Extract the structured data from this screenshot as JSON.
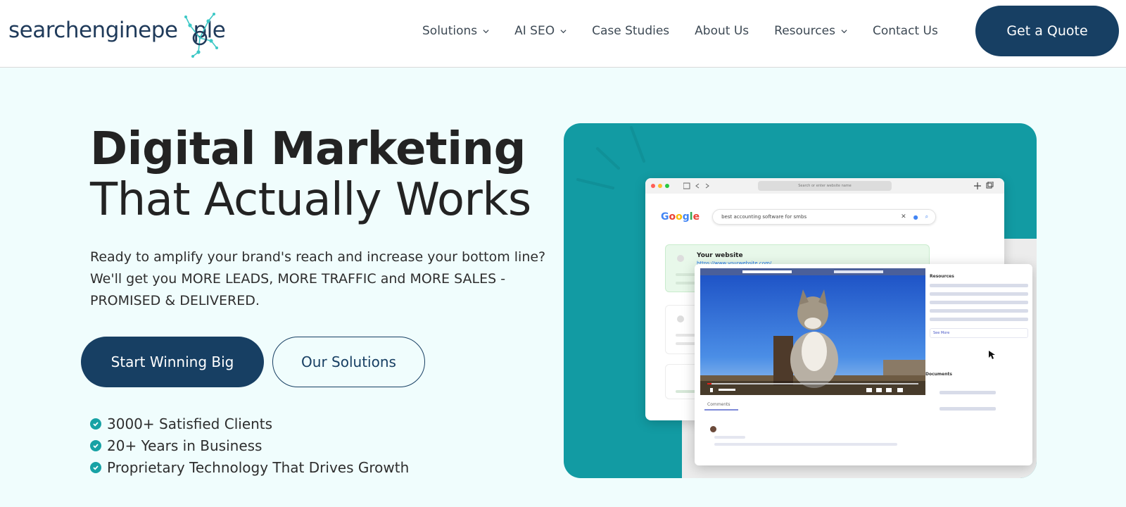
{
  "brand": {
    "logo_text_a": "searchenginepe",
    "logo_text_b": "ple",
    "primary": "#173f63",
    "accent": "#17a2a5",
    "hero_bg": "#f0fdfd"
  },
  "nav": {
    "items": [
      {
        "label": "Solutions",
        "dropdown": true
      },
      {
        "label": "AI SEO",
        "dropdown": true
      },
      {
        "label": "Case Studies",
        "dropdown": false
      },
      {
        "label": "About Us",
        "dropdown": false
      },
      {
        "label": "Resources",
        "dropdown": true
      },
      {
        "label": "Contact Us",
        "dropdown": false
      }
    ],
    "cta": "Get a Quote"
  },
  "hero": {
    "title_line1": "Digital Marketing",
    "title_line2": "That Actually Works",
    "description": "Ready to amplify your brand's reach and increase your bottom line? We'll get you MORE LEADS, MORE TRAFFIC and MORE SALES - PROMISED & DELIVERED.",
    "primary_button": "Start Winning Big",
    "secondary_button": "Our Solutions",
    "benefits": [
      "3000+ Satisfied Clients",
      "20+ Years in Business",
      "Proprietary Technology That Drives Growth"
    ]
  },
  "illustration": {
    "url_placeholder": "Search or enter website name",
    "search_query": "best accounting software for smbs",
    "result_title": "Your website",
    "result_url": "https://www.yourwebsite.com/",
    "side_resources": "Resources",
    "side_see_more": "See More",
    "side_documents": "Documents",
    "comments_tab": "Comments",
    "google_letters": [
      "G",
      "o",
      "o",
      "g",
      "l",
      "e"
    ],
    "google_colors": [
      "#4285F4",
      "#EA4335",
      "#FBBC05",
      "#4285F4",
      "#34A853",
      "#EA4335"
    ]
  }
}
